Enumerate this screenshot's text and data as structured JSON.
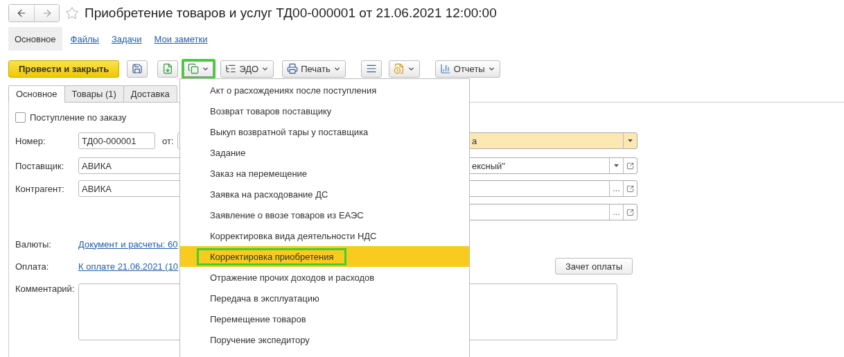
{
  "window": {
    "title": "Приобретение товаров и услуг ТД00-000001 от 21.06.2021 12:00:00",
    "favorite": false
  },
  "nav_tabs": [
    {
      "label": "Основное",
      "selected": true
    },
    {
      "label": "Файлы",
      "selected": false
    },
    {
      "label": "Задачи",
      "selected": false
    },
    {
      "label": "Мои заметки",
      "selected": false
    }
  ],
  "toolbar": [
    {
      "kind": "primary",
      "label": "Провести и закрыть",
      "highlighted": false
    },
    {
      "kind": "icon",
      "highlighted": false
    },
    {
      "kind": "icon",
      "highlighted": false
    },
    {
      "kind": "icon_menu",
      "highlighted": true
    },
    {
      "kind": "menu",
      "label": "ЭДО",
      "highlighted": false
    },
    {
      "kind": "menu",
      "label": "Печать",
      "highlighted": false
    },
    {
      "kind": "icon",
      "highlighted": false
    },
    {
      "kind": "icon_menu",
      "highlighted": false
    },
    {
      "kind": "menu",
      "label": "Отчеты",
      "highlighted": false
    }
  ],
  "form_tabs": [
    {
      "label": "Основное",
      "selected": true
    },
    {
      "label": "Товары (1)",
      "selected": false
    },
    {
      "label": "Доставка",
      "selected": false
    }
  ],
  "order_checkbox": {
    "label": "Поступление по заказу",
    "checked": false
  },
  "rows": [
    {
      "label": "Номер:",
      "value": "ТД00-000001",
      "date_label": "от:",
      "side_field": {
        "value": "а",
        "tinted": true,
        "buttons": [
          {
            "kind": "dropdown"
          }
        ]
      }
    },
    {
      "label": "Поставщик:",
      "value": "АВИКА",
      "side_field": {
        "value": "ексный\"",
        "tinted": false,
        "buttons": [
          {
            "kind": "dropdown"
          },
          {
            "kind": "open"
          }
        ]
      }
    },
    {
      "label": "Контрагент:",
      "value": "АВИКА",
      "side_field": {
        "tinted": false,
        "buttons": [
          {
            "kind": "select",
            "label": "..."
          },
          {
            "kind": "open"
          }
        ]
      }
    },
    {
      "side_field": {
        "tinted": false,
        "buttons": [
          {
            "kind": "select",
            "label": "..."
          },
          {
            "kind": "open"
          }
        ]
      }
    }
  ],
  "currency": {
    "label": "Валюты:",
    "link": "Документ и расчеты: 60"
  },
  "payment": {
    "label": "Оплата:",
    "link": "К оплате 21.06.2021 (10",
    "button": "Зачет оплаты"
  },
  "comment": {
    "label": "Комментарий:"
  },
  "menu": [
    {
      "label": "Акт о расхождениях после поступления",
      "selected": false,
      "highlighted": false
    },
    {
      "label": "Возврат товаров поставщику",
      "selected": false,
      "highlighted": false
    },
    {
      "label": "Выкуп возвратной тары у поставщика",
      "selected": false,
      "highlighted": false
    },
    {
      "label": "Задание",
      "selected": false,
      "highlighted": false
    },
    {
      "label": "Заказ на перемещение",
      "selected": false,
      "highlighted": false
    },
    {
      "label": "Заявка на расходование ДС",
      "selected": false,
      "highlighted": false
    },
    {
      "label": "Заявление о ввозе товаров из ЕАЭС",
      "selected": false,
      "highlighted": false
    },
    {
      "label": "Корректировка вида деятельности НДС",
      "selected": false,
      "highlighted": false
    },
    {
      "label": "Корректировка приобретения",
      "selected": true,
      "highlighted": true
    },
    {
      "label": "Отражение прочих доходов и расходов",
      "selected": false,
      "highlighted": false
    },
    {
      "label": "Передача в эксплуатацию",
      "selected": false,
      "highlighted": false
    },
    {
      "label": "Перемещение товаров",
      "selected": false,
      "highlighted": false
    },
    {
      "label": "Поручение экспедитору",
      "selected": false,
      "highlighted": false
    }
  ]
}
